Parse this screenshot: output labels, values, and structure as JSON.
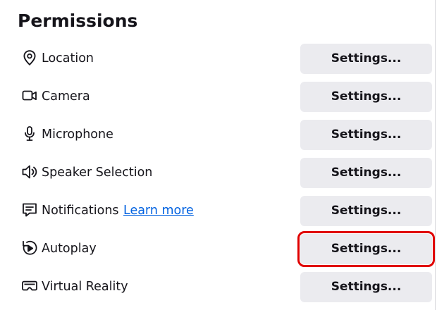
{
  "section": {
    "title": "Permissions"
  },
  "permissions": [
    {
      "label": "Location",
      "icon": "location-pin-icon",
      "button_label": "Settings..."
    },
    {
      "label": "Camera",
      "icon": "camera-icon",
      "button_label": "Settings..."
    },
    {
      "label": "Microphone",
      "icon": "microphone-icon",
      "button_label": "Settings..."
    },
    {
      "label": "Speaker Selection",
      "icon": "speaker-icon",
      "button_label": "Settings..."
    },
    {
      "label": "Notifications",
      "icon": "notification-icon",
      "button_label": "Settings...",
      "link_label": "Learn more"
    },
    {
      "label": "Autoplay",
      "icon": "autoplay-icon",
      "button_label": "Settings...",
      "highlighted": true
    },
    {
      "label": "Virtual Reality",
      "icon": "vr-headset-icon",
      "button_label": "Settings..."
    }
  ],
  "colors": {
    "highlight": "#e00000",
    "link": "#0061e0",
    "button_bg": "#ebebef"
  }
}
